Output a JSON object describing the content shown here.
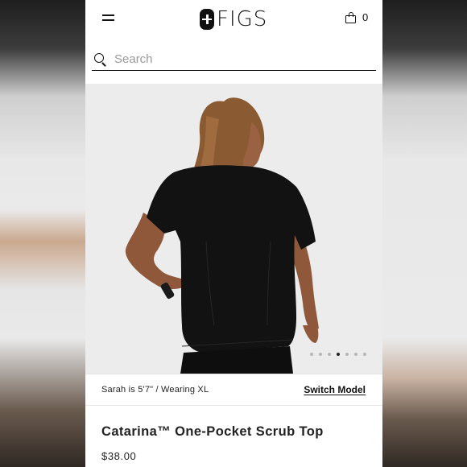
{
  "header": {
    "logo_text": "FIGS",
    "cart_count": "0"
  },
  "search": {
    "placeholder": "Search"
  },
  "product": {
    "model_info": "Sarah is 5'7\" / Wearing XL",
    "switch_model_label": "Switch Model",
    "title": "Catarina™ One-Pocket Scrub Top",
    "price": "$38.00",
    "image_count": 7,
    "active_image": 4
  },
  "colors": {
    "brand": "#111111",
    "background": "#ffffff",
    "image_bg": "#ececec"
  }
}
